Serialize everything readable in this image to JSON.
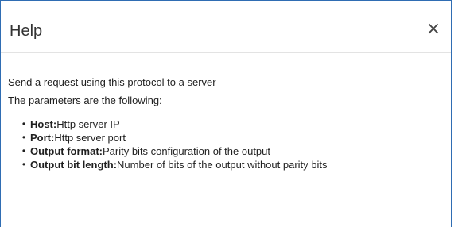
{
  "dialog": {
    "title": "Help",
    "close_label": "×"
  },
  "content": {
    "intro": "Send a request using this protocol to a server",
    "params_intro": "The parameters are the following:",
    "bullet": "•",
    "parameters": [
      {
        "name": "Host:",
        "description": "Http server IP"
      },
      {
        "name": "Port:",
        "description": "Http server port"
      },
      {
        "name": "Output format:",
        "description": "Parity bits configuration of the output"
      },
      {
        "name": "Output bit length:",
        "description": "Number of bits of the output without parity bits"
      }
    ]
  },
  "colors": {
    "frame_border": "#2f6db3",
    "header_divider": "#e3e3e3",
    "text": "#1f1f1f"
  }
}
